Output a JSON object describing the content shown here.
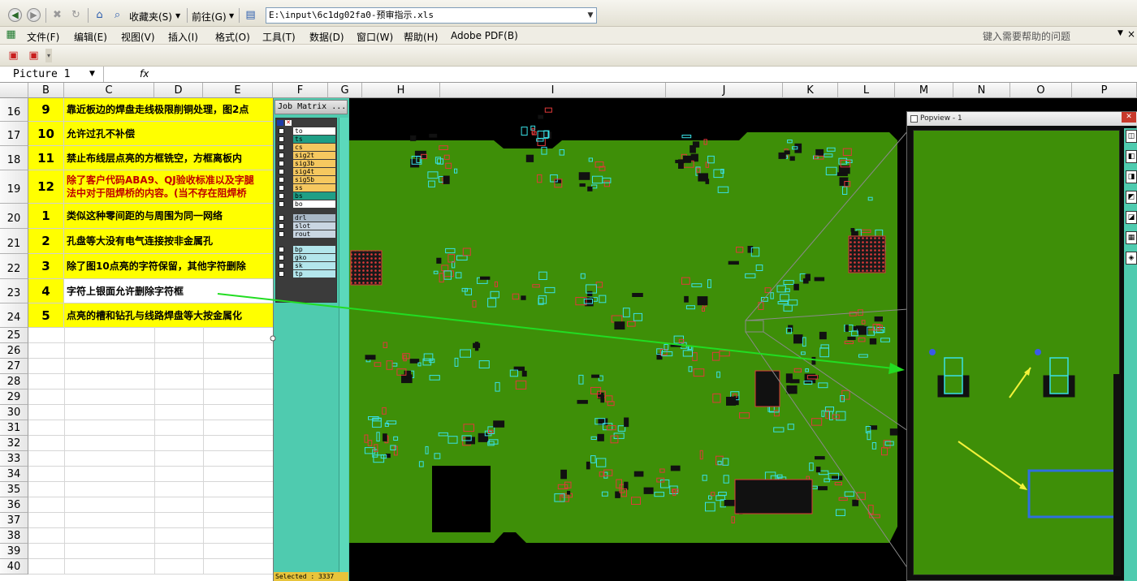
{
  "toolbar": {
    "favorites_label": "收藏夹(S)",
    "goto_label": "前往(G)",
    "address": "E:\\input\\6c1dg02fa0-预审指示.xls"
  },
  "menu": {
    "items": [
      "文件(F)",
      "编辑(E)",
      "视图(V)",
      "插入(I)",
      "格式(O)",
      "工具(T)",
      "数据(D)",
      "窗口(W)",
      "帮助(H)",
      "Adobe PDF(B)"
    ],
    "help_placeholder": "键入需要帮助的问题"
  },
  "formula_bar": {
    "name_box": "Picture 1",
    "fx": "fx"
  },
  "columns": [
    "B",
    "C",
    "D",
    "E",
    "F",
    "G",
    "H",
    "I",
    "J",
    "K",
    "L",
    "M",
    "N",
    "O",
    "P"
  ],
  "rows": [
    {
      "row": "16",
      "num": "9",
      "text": "靠近板边的焊盘走线极限削铜处理，图2点",
      "color": "#000000"
    },
    {
      "row": "17",
      "num": "10",
      "text": "允许过孔不补偿",
      "color": "#000000"
    },
    {
      "row": "18",
      "num": "11",
      "text": "禁止布线层点亮的方框铣空，方框离板内",
      "color": "#000000"
    },
    {
      "row": "19",
      "num": "12",
      "text": "除了客户代码ABA9、QJ验收标准以及字腿",
      "text2": "法中对于阻焊桥的内容。(当不存在阻焊桥",
      "color": "#c00000"
    },
    {
      "row": "20",
      "num": "1",
      "text": "类似这种零间距的与周围为同一网络",
      "color": "#000000"
    },
    {
      "row": "21",
      "num": "2",
      "text": "孔盘等大没有电气连接按非金属孔",
      "color": "#000000"
    },
    {
      "row": "22",
      "num": "3",
      "text": "除了图10点亮的字符保留，其他字符删除",
      "color": "#000000"
    },
    {
      "row": "23",
      "num": "4",
      "text": "字符上银面允许删除字符框",
      "color": "#000000"
    },
    {
      "row": "24",
      "num": "5",
      "text": "点亮的槽和钻孔与线路焊盘等大按金属化",
      "color": "#000000"
    }
  ],
  "empty_rows": [
    "25",
    "26",
    "27",
    "28",
    "29",
    "30",
    "31",
    "32",
    "33",
    "34",
    "35",
    "36",
    "37",
    "38",
    "39",
    "40"
  ],
  "job_matrix": {
    "title": "Job Matrix ...",
    "layers": [
      {
        "name": "to",
        "color": "#ffffff"
      },
      {
        "name": "ts",
        "color": "#1f9f86"
      },
      {
        "name": "cs",
        "color": "#f6c85f"
      },
      {
        "name": "sig2t",
        "color": "#f6c85f"
      },
      {
        "name": "sig3b",
        "color": "#f6c85f"
      },
      {
        "name": "sig4t",
        "color": "#f6c85f"
      },
      {
        "name": "sig5b",
        "color": "#f6c85f"
      },
      {
        "name": "ss",
        "color": "#f6c85f"
      },
      {
        "name": "bs",
        "color": "#1f9f86"
      },
      {
        "name": "bo",
        "color": "#ffffff"
      },
      {
        "name": "drl",
        "color": "#a9b8c6"
      },
      {
        "name": "slot",
        "color": "#c9d6e2"
      },
      {
        "name": "rout",
        "color": "#c9d6e2"
      },
      {
        "name": "bp",
        "color": "#b3e6ec"
      },
      {
        "name": "gko",
        "color": "#b3e6ec"
      },
      {
        "name": "sk",
        "color": "#b3e6ec"
      },
      {
        "name": "tp",
        "color": "#b3e6ec"
      }
    ],
    "status": "Selected : 3337"
  },
  "popview": {
    "title": "Popview - 1"
  },
  "colors": {
    "highlight": "#ffff00",
    "board_green": "#3e8f08",
    "pad_cyan": "#39e0e6",
    "arrow_green": "#22dd22",
    "arrow_yellow": "#f2f23a"
  }
}
